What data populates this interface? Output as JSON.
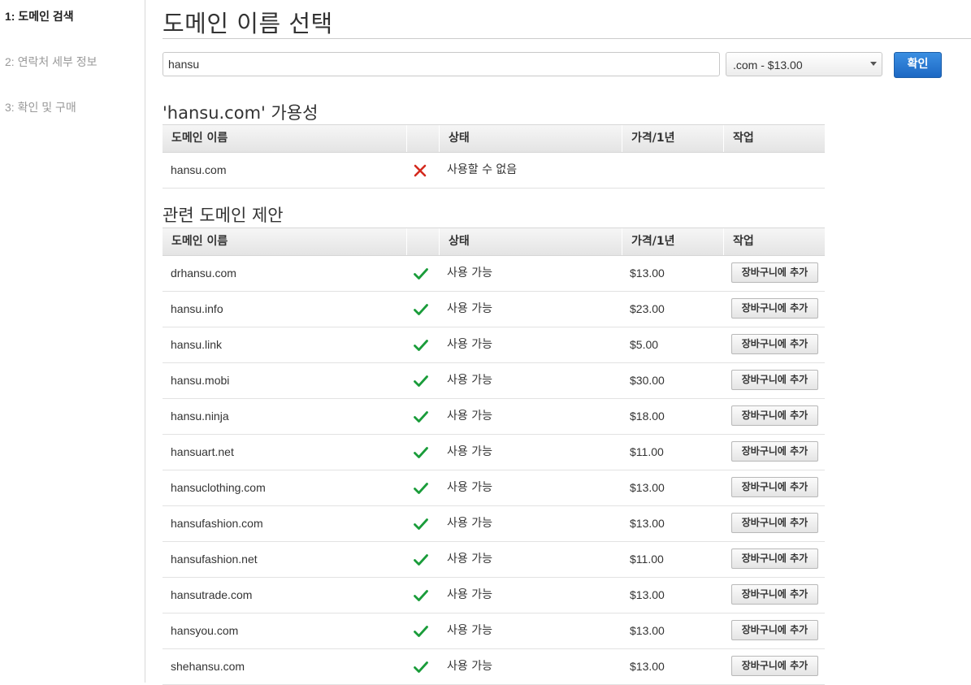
{
  "steps": [
    {
      "label": "1: 도메인 검색",
      "active": true
    },
    {
      "label": "2: 연락처 세부 정보",
      "active": false
    },
    {
      "label": "3: 확인 및 구매",
      "active": false
    }
  ],
  "page_title": "도메인 이름 선택",
  "search": {
    "value": "hansu"
  },
  "tld_select": {
    "selected": ".com - $13.00"
  },
  "confirm_label": "확인",
  "availability": {
    "heading": "'hansu.com' 가용성",
    "columns": [
      "도메인 이름",
      "",
      "상태",
      "가격/1년",
      "작업"
    ],
    "rows": [
      {
        "name": "hansu.com",
        "icon": "cross-icon",
        "status": "사용할 수 없음",
        "price": "",
        "action": ""
      }
    ]
  },
  "suggestions": {
    "heading": "관련 도메인 제안",
    "columns": [
      "도메인 이름",
      "",
      "상태",
      "가격/1년",
      "작업"
    ],
    "rows": [
      {
        "name": "drhansu.com",
        "icon": "check-icon",
        "status": "사용 가능",
        "price": "$13.00",
        "action": "장바구니에 추가"
      },
      {
        "name": "hansu.info",
        "icon": "check-icon",
        "status": "사용 가능",
        "price": "$23.00",
        "action": "장바구니에 추가"
      },
      {
        "name": "hansu.link",
        "icon": "check-icon",
        "status": "사용 가능",
        "price": "$5.00",
        "action": "장바구니에 추가"
      },
      {
        "name": "hansu.mobi",
        "icon": "check-icon",
        "status": "사용 가능",
        "price": "$30.00",
        "action": "장바구니에 추가"
      },
      {
        "name": "hansu.ninja",
        "icon": "check-icon",
        "status": "사용 가능",
        "price": "$18.00",
        "action": "장바구니에 추가"
      },
      {
        "name": "hansuart.net",
        "icon": "check-icon",
        "status": "사용 가능",
        "price": "$11.00",
        "action": "장바구니에 추가"
      },
      {
        "name": "hansuclothing.com",
        "icon": "check-icon",
        "status": "사용 가능",
        "price": "$13.00",
        "action": "장바구니에 추가"
      },
      {
        "name": "hansufashion.com",
        "icon": "check-icon",
        "status": "사용 가능",
        "price": "$13.00",
        "action": "장바구니에 추가"
      },
      {
        "name": "hansufashion.net",
        "icon": "check-icon",
        "status": "사용 가능",
        "price": "$11.00",
        "action": "장바구니에 추가"
      },
      {
        "name": "hansutrade.com",
        "icon": "check-icon",
        "status": "사용 가능",
        "price": "$13.00",
        "action": "장바구니에 추가"
      },
      {
        "name": "hansyou.com",
        "icon": "check-icon",
        "status": "사용 가능",
        "price": "$13.00",
        "action": "장바구니에 추가"
      },
      {
        "name": "shehansu.com",
        "icon": "check-icon",
        "status": "사용 가능",
        "price": "$13.00",
        "action": "장바구니에 추가"
      }
    ]
  },
  "colors": {
    "check": "#1a9c3a",
    "cross": "#d42a1e",
    "primary_button": "#1c67c3"
  }
}
